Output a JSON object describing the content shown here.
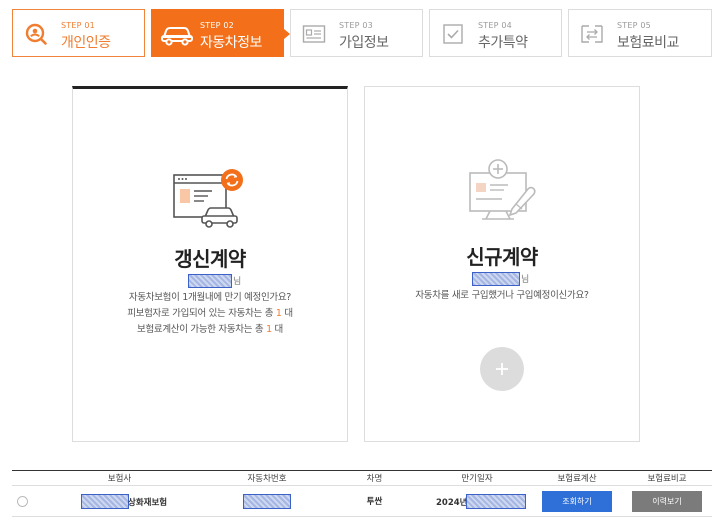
{
  "steps": [
    {
      "num": "STEP 01",
      "label": "개인인증",
      "icon": "search-person-icon",
      "state": "done"
    },
    {
      "num": "STEP 02",
      "label": "자동차정보",
      "icon": "car-icon",
      "state": "active"
    },
    {
      "num": "STEP 03",
      "label": "가입정보",
      "icon": "id-card-icon",
      "state": "todo"
    },
    {
      "num": "STEP 04",
      "label": "추가특약",
      "icon": "checkbox-icon",
      "state": "todo"
    },
    {
      "num": "STEP 05",
      "label": "보험료비교",
      "icon": "compare-icon",
      "state": "todo"
    }
  ],
  "renew_card": {
    "title": "갱신계약",
    "name_suffix": "님",
    "line1": "자동차보험이 1개월내에 만기 예정인가요?",
    "line2_pre": "피보험자로 가입되어 있는 자동차는 총 ",
    "line2_count": "1",
    "line2_post": " 대",
    "line3_pre": "보험료계산이 가능한 자동차는 총 ",
    "line3_count": "1",
    "line3_post": " 대"
  },
  "new_card": {
    "title": "신규계약",
    "name_suffix": "님",
    "line1": "자동차를 새로 구입했거나 구입예정이신가요?"
  },
  "table": {
    "headers": [
      "보험사",
      "자동차번호",
      "차명",
      "만기일자",
      "보험료계산",
      "보험료비교"
    ],
    "row": {
      "insurer_suffix": "상화재보험",
      "car_name": "투싼",
      "date_prefix": "2024년",
      "calc_button": "조회하기",
      "compare_button": "이력보기"
    }
  },
  "colors": {
    "accent": "#f36f1a",
    "blue_button": "#2e6fd8",
    "gray_button": "#7b7b7b"
  }
}
